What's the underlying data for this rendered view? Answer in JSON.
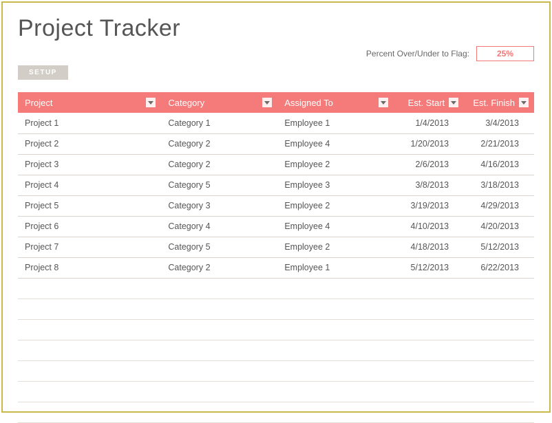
{
  "title": "Project Tracker",
  "flag": {
    "label": "Percent Over/Under to Flag:",
    "value": "25%"
  },
  "setup_label": "SETUP",
  "columns": {
    "project": "Project",
    "category": "Category",
    "assigned": "Assigned To",
    "start": "Est. Start",
    "finish": "Est. Finish"
  },
  "rows": [
    {
      "project": "Project 1",
      "category": "Category 1",
      "assigned": "Employee 1",
      "start": "1/4/2013",
      "finish": "3/4/2013"
    },
    {
      "project": "Project 2",
      "category": "Category 2",
      "assigned": "Employee 4",
      "start": "1/20/2013",
      "finish": "2/21/2013"
    },
    {
      "project": "Project 3",
      "category": "Category 2",
      "assigned": "Employee 2",
      "start": "2/6/2013",
      "finish": "4/16/2013"
    },
    {
      "project": "Project 4",
      "category": "Category 5",
      "assigned": "Employee 3",
      "start": "3/8/2013",
      "finish": "3/18/2013"
    },
    {
      "project": "Project 5",
      "category": "Category 3",
      "assigned": "Employee 2",
      "start": "3/19/2013",
      "finish": "4/29/2013"
    },
    {
      "project": "Project 6",
      "category": "Category 4",
      "assigned": "Employee 4",
      "start": "4/10/2013",
      "finish": "4/20/2013"
    },
    {
      "project": "Project 7",
      "category": "Category 5",
      "assigned": "Employee 2",
      "start": "4/18/2013",
      "finish": "5/12/2013"
    },
    {
      "project": "Project 8",
      "category": "Category 2",
      "assigned": "Employee 1",
      "start": "5/12/2013",
      "finish": "6/22/2013"
    }
  ],
  "empty_row_count": 7,
  "colors": {
    "border": "#c9b94a",
    "accent": "#f47b7a"
  }
}
